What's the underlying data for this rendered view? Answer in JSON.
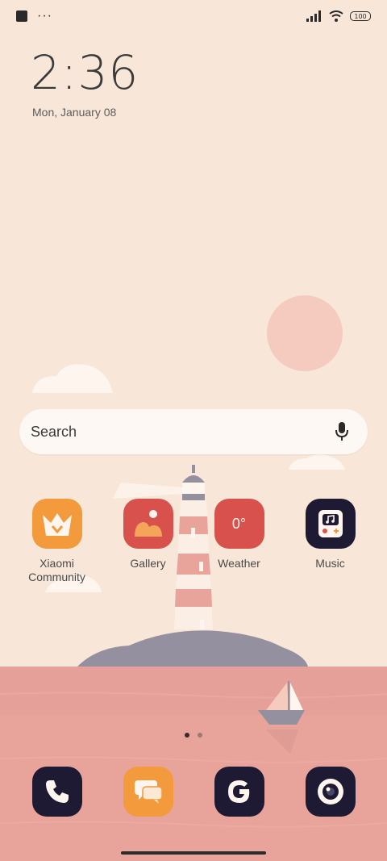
{
  "status_bar": {
    "overflow_dots": "···",
    "battery_level": "100",
    "icons": [
      "app-notification-icon",
      "signal-icon",
      "wifi-icon",
      "battery-icon"
    ]
  },
  "clock": {
    "time": "2:36",
    "date": "Mon, January 08"
  },
  "search": {
    "placeholder": "Search"
  },
  "apps": [
    {
      "label": "Xiaomi Community",
      "icon": "crown-icon",
      "color": "#f29a3c"
    },
    {
      "label": "Gallery",
      "icon": "gallery-icon",
      "color": "#d9514c"
    },
    {
      "label": "Weather",
      "icon_text": "0°",
      "color": "#d9514c"
    },
    {
      "label": "Music",
      "icon": "music-icon",
      "color": "#1e1a33"
    }
  ],
  "dock": [
    {
      "icon": "phone-icon",
      "color": "#1e1a33"
    },
    {
      "icon": "messages-icon",
      "color": "#f29a3c"
    },
    {
      "icon": "google-icon",
      "color": "#1e1a33"
    },
    {
      "icon": "camera-icon",
      "color": "#1e1a33"
    }
  ],
  "page_indicator": {
    "pages": 2,
    "current": 1
  },
  "colors": {
    "sky": "#f8e7d8",
    "sea": "#e8a39b",
    "sun": "#f5cbbf",
    "island": "#9590a0"
  }
}
